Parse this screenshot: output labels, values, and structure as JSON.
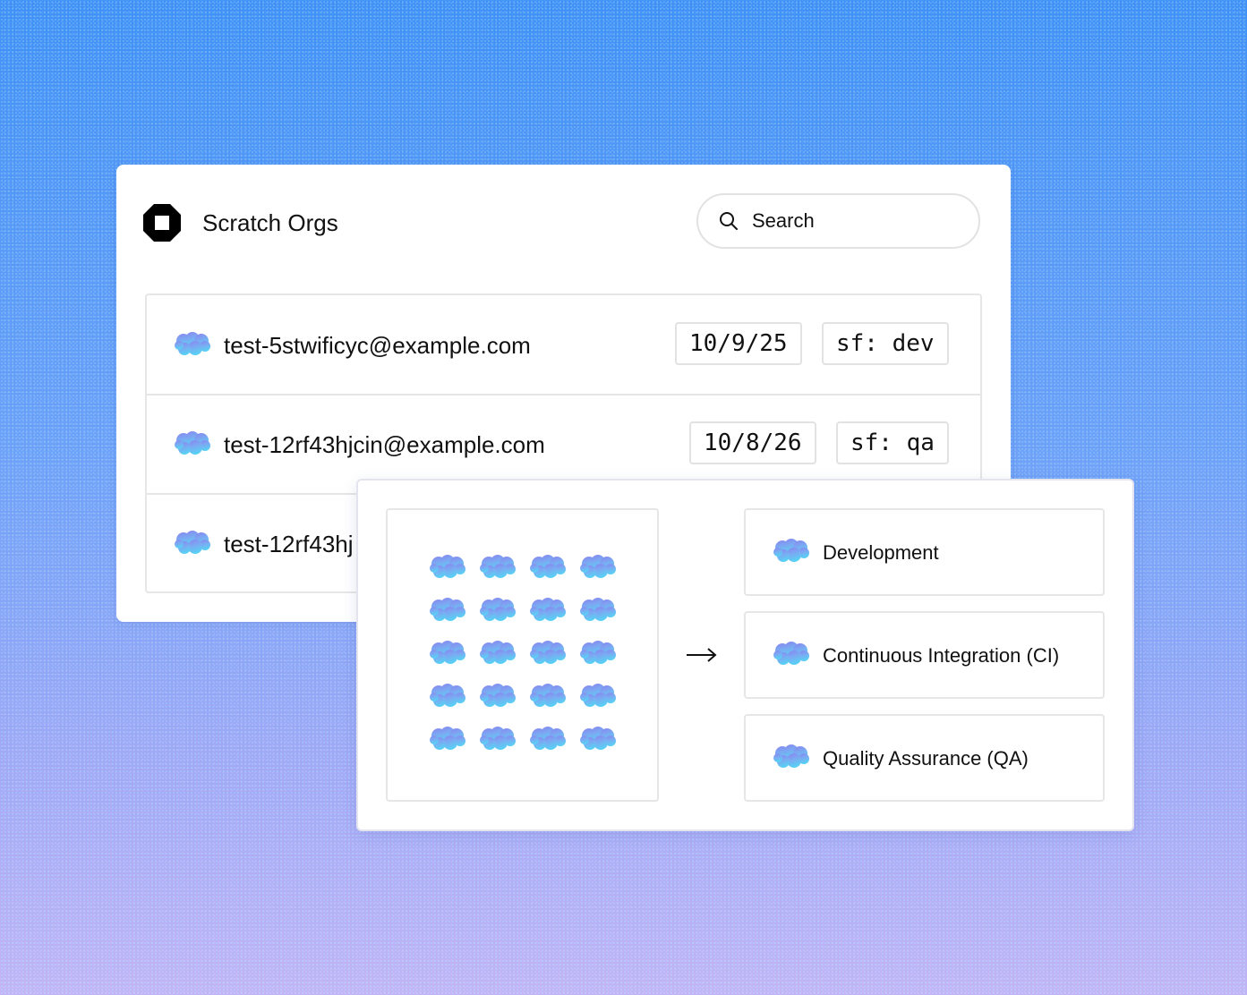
{
  "colors": {
    "background_top": "#3f8ef5",
    "background_bottom": "#c4b3f6",
    "cloud_top": "#8a84f0",
    "cloud_bottom": "#58d0f4"
  },
  "header": {
    "logo_icon": "brand-logo-icon",
    "title": "Scratch Orgs",
    "search": {
      "icon": "search-icon",
      "label": "Search"
    }
  },
  "orgs": [
    {
      "icon": "cloud-icon",
      "email": "test-5stwificyc@example.com",
      "date": "10/9/25",
      "alias": "sf: dev"
    },
    {
      "icon": "cloud-icon",
      "email": "test-12rf43hjcin@example.com",
      "date": "10/8/26",
      "alias": "sf: qa"
    },
    {
      "icon": "cloud-icon",
      "email": "test-12rf43hj"
    }
  ],
  "pool": {
    "icon": "cloud-icon",
    "rows": 5,
    "columns": 4,
    "arrow_icon": "arrow-right-icon"
  },
  "environments": [
    {
      "icon": "cloud-icon",
      "label": "Development"
    },
    {
      "icon": "cloud-icon",
      "label": "Continuous Integration (CI)"
    },
    {
      "icon": "cloud-icon",
      "label": "Quality Assurance (QA)"
    }
  ]
}
